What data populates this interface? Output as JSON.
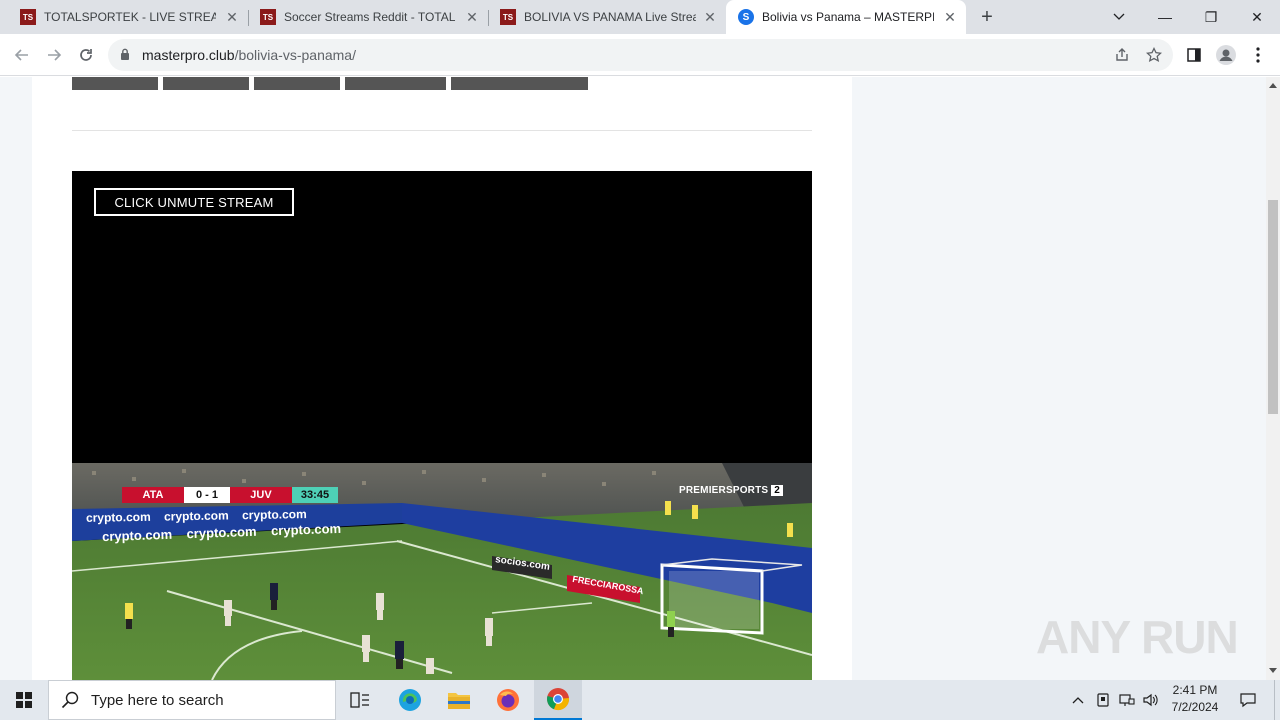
{
  "browser": {
    "tabs": [
      {
        "favicon": "TS",
        "title": "TOTALSPORTEK - LIVE STREAMS",
        "active": false
      },
      {
        "favicon": "TS",
        "title": "Soccer Streams Reddit - TOTALSPORTEK",
        "active": false
      },
      {
        "favicon": "TS",
        "title": "BOLIVIA VS PANAMA Live Stream",
        "active": false
      },
      {
        "favicon": "S",
        "title": "Bolivia vs Panama – MASTERPRO",
        "active": true
      }
    ],
    "close_glyph": "✕",
    "new_tab_glyph": "+",
    "window_controls": {
      "minimize": "—",
      "restore": "❐",
      "close": "✕"
    },
    "address": {
      "host": "masterpro.club",
      "path": "/bolivia-vs-panama/"
    }
  },
  "page": {
    "unmute_label": "CLICK UNMUTE STREAM",
    "video": {
      "home_team": "ATA",
      "score": "0 - 1",
      "away_team": "JUV",
      "clock": "33:45",
      "network": "PREMIERSPORTS",
      "network_number": "2",
      "board_ads": [
        "crypto.com",
        "crypto.com",
        "crypto.com",
        "crypto.com",
        "crypto.com",
        "crypto.com"
      ],
      "ad_socios": "socios.com",
      "ad_frecciarossa": "FRECCIAROSSA"
    }
  },
  "watermark": "ANY RUN",
  "taskbar": {
    "search_placeholder": "Type here to search",
    "time": "2:41 PM",
    "date": "7/2/2024"
  }
}
